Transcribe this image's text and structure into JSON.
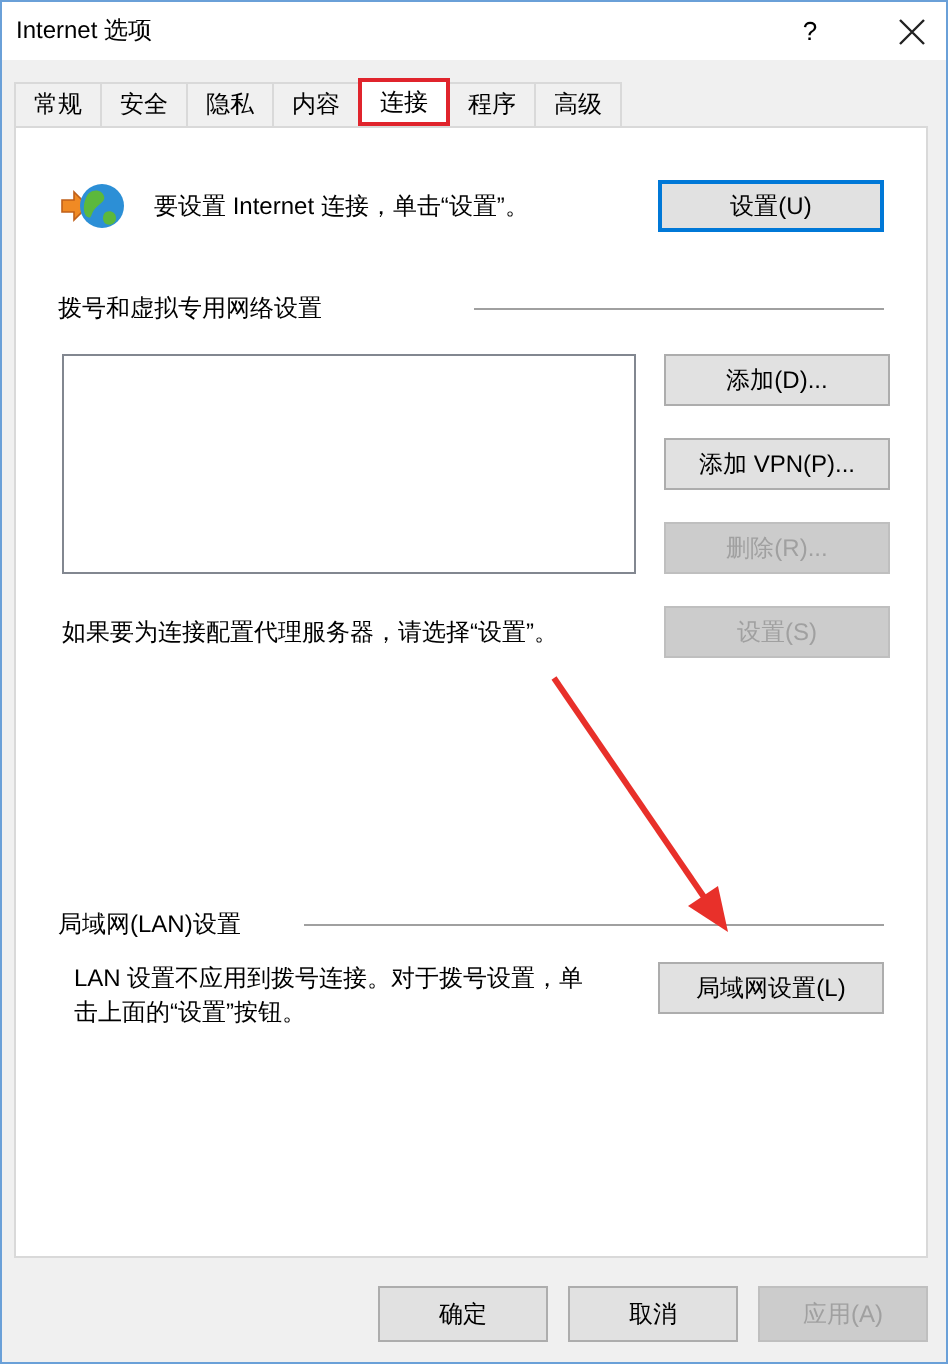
{
  "window": {
    "title": "Internet 选项",
    "help": "?"
  },
  "tabs": [
    {
      "label": "常规",
      "selected": false,
      "highlighted": false
    },
    {
      "label": "安全",
      "selected": false,
      "highlighted": false
    },
    {
      "label": "隐私",
      "selected": false,
      "highlighted": false
    },
    {
      "label": "内容",
      "selected": false,
      "highlighted": false
    },
    {
      "label": "连接",
      "selected": true,
      "highlighted": true
    },
    {
      "label": "程序",
      "selected": false,
      "highlighted": false
    },
    {
      "label": "高级",
      "selected": false,
      "highlighted": false
    }
  ],
  "connection": {
    "text": "要设置 Internet 连接，单击“设置”。",
    "button": {
      "label": "设置(U)",
      "default": true,
      "disabled": false
    }
  },
  "vpn": {
    "heading": "拨号和虚拟专用网络设置",
    "note": "如果要为连接配置代理服务器，请选择“设置”。",
    "buttons": [
      {
        "label": "添加(D)...",
        "disabled": false
      },
      {
        "label": "添加 VPN(P)...",
        "disabled": false
      },
      {
        "label": "删除(R)...",
        "disabled": true
      },
      {
        "label": "设置(S)",
        "disabled": true
      }
    ]
  },
  "lan": {
    "heading": "局域网(LAN)设置",
    "text": "LAN 设置不应用到拨号连接。对于拨号设置，单击上面的“设置”按钮。",
    "button": {
      "label": "局域网设置(L)",
      "disabled": false
    }
  },
  "footer_buttons": [
    {
      "label": "确定",
      "disabled": false
    },
    {
      "label": "取消",
      "disabled": false
    },
    {
      "label": "应用(A)",
      "disabled": true
    }
  ],
  "annotations": [
    {
      "kind": "arrow"
    }
  ]
}
